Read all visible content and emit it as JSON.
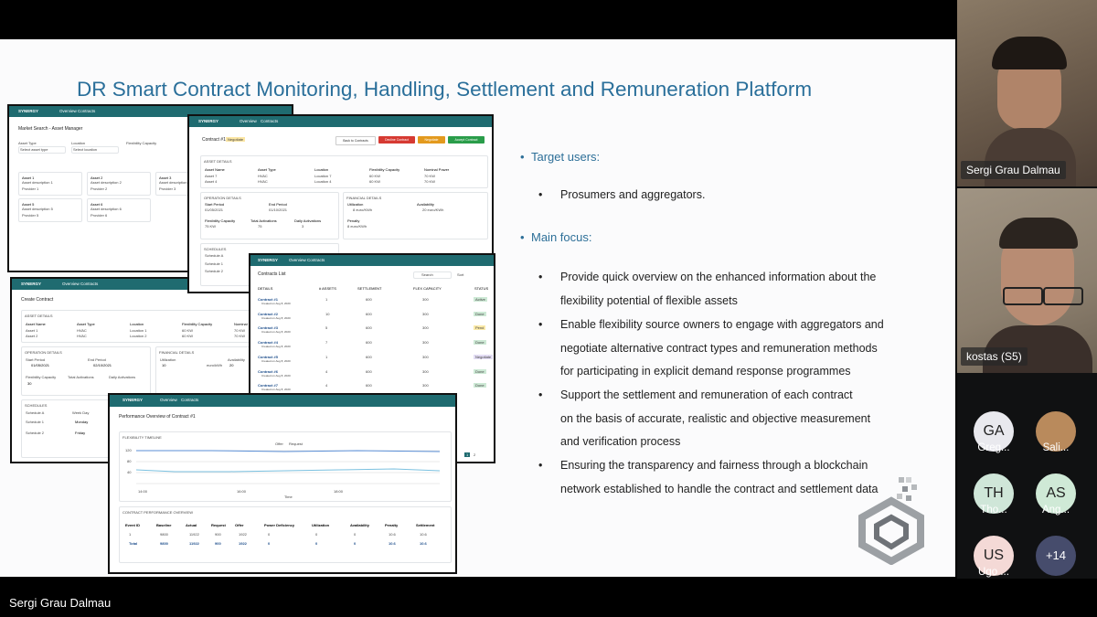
{
  "slide": {
    "title": "DR Smart Contract Monitoring, Handling, Settlement and Remuneration Platform",
    "sections": [
      {
        "heading": "Target users:",
        "items": [
          "Prosumers and aggregators."
        ]
      },
      {
        "heading": "Main focus:",
        "items": [
          [
            "Provide quick overview on the enhanced information about the",
            "flexibility potential of flexible assets"
          ],
          [
            "Enable flexibility source owners to engage with aggregators and",
            "negotiate alternative contract types and remuneration methods",
            "for participating in explicit demand response programmes"
          ],
          [
            "Support the  settlement and remuneration of each contract",
            "on the basis of accurate, realistic and objective measurement",
            "and verification process"
          ],
          [
            "Ensuring the transparency and fairness through a blockchain",
            "network established to handle the contract and settlement data"
          ]
        ]
      }
    ]
  },
  "mockups": {
    "brand": "SYNERGY",
    "nav": [
      "Overview",
      "Contracts"
    ],
    "market": {
      "title": "Market Search - Asset Manager",
      "filters": [
        "Asset Type",
        "Location",
        "Flexibility Capacity"
      ],
      "filter_placeholders": [
        "Select asset type",
        "Select location"
      ],
      "assets": [
        {
          "name": "Asset 1",
          "desc": "Asset description 1",
          "provider": "Provider 1"
        },
        {
          "name": "Asset 2",
          "desc": "Asset description 2",
          "provider": "Provider 2"
        },
        {
          "name": "Asset 3",
          "desc": "Asset description 3",
          "provider": "Provider 3"
        },
        {
          "name": "Asset 5",
          "desc": "Asset description 5",
          "provider": "Provider 5"
        },
        {
          "name": "Asset 6",
          "desc": "Asset description 6",
          "provider": "Provider 6"
        }
      ]
    },
    "contract": {
      "title": "Contract #11",
      "badge": "Negotiate",
      "buttons": [
        "Back to Contracts",
        "Decline Contract",
        "Negotiate",
        "Accept Contract"
      ],
      "asset_details_label": "ASSET DETAILS",
      "asset_cols": [
        "Asset Name",
        "Asset Type",
        "Location",
        "Flexibility Capacity",
        "Nominal Power"
      ],
      "asset_rows": [
        [
          "Asset 7",
          "HVAC",
          "Location 7",
          "60 KW",
          "70 KW"
        ],
        [
          "Asset 4",
          "HVAC",
          "Location 4",
          "60 KW",
          "70 KW"
        ]
      ],
      "operation_label": "OPERATION DETAILS",
      "start_period_label": "Start Period",
      "start_period": "01/05/2021",
      "end_period_label": "End Period",
      "end_period": "01/10/2021",
      "flex_cap_label": "Flexibility Capacity",
      "flex_cap": "75 KW",
      "total_act_label": "Total Activations",
      "total_act": "75",
      "daily_act_label": "Daily Activations",
      "daily_act": "3",
      "financial_label": "FINANCIAL DETAILS",
      "utilization_label": "Utilization",
      "utilization": "8 euro/KWh",
      "availability_label": "Availability",
      "availability": "20 euro/KWh",
      "penalty_label": "Penalty",
      "penalty": "8 euro/KWh",
      "schedules_label": "SCHEDULES",
      "schedules": [
        "Schedule A",
        "Schedule 1",
        "Schedule 2"
      ]
    },
    "create": {
      "title": "Create Contract",
      "asset_details_label": "ASSET DETAILS",
      "asset_cols": [
        "Asset Name",
        "Asset Type",
        "Location",
        "Flexibility Capacity",
        "Nominal Po"
      ],
      "asset_rows": [
        [
          "Asset 1",
          "HVAC",
          "Location 1",
          "60 KW",
          "70 KW"
        ],
        [
          "Asset 2",
          "HVAC",
          "Location 2",
          "60 KW",
          "70 KW"
        ]
      ],
      "operation_label": "OPERATION DETAILS",
      "start_label": "Start Period",
      "start": "01/05/2021",
      "end_label": "End Period",
      "end": "02/10/2021",
      "financial_label": "FINANCIAL DETAILS",
      "utilization_label": "Utilization",
      "utilization": "10",
      "unit": "euro/kWh",
      "availability_label": "Availability",
      "availability": "20",
      "flex_label": "Flexibility Capacity",
      "flex": "30",
      "total_label": "Total Activations",
      "daily_label": "Daily Activations",
      "schedules_label": "SCHEDULES",
      "schedule_a": "Schedule A",
      "week_day": "Week Day",
      "schedule_1": "Schedule 1",
      "schedule_2": "Schedule 2",
      "monday": "Monday",
      "friday": "Friday"
    },
    "contracts_list": {
      "title": "Contracts List",
      "search": "Search",
      "sort": "Sort",
      "cols": [
        "DETAILS",
        "# ASSETS",
        "SETTLEMENT",
        "FLEX CAPACITY",
        "STATUS"
      ],
      "rows": [
        {
          "name": "Contract #1",
          "date": "Created on Aug 8, 2020",
          "assets": "1",
          "settlement": "600",
          "flex": "300",
          "status": "Active",
          "color": "#cde9d5"
        },
        {
          "name": "Contract #2",
          "date": "Created on Aug 8, 2020",
          "assets": "10",
          "settlement": "600",
          "flex": "300",
          "status": "Done",
          "color": "#cde9d5"
        },
        {
          "name": "Contract #3",
          "date": "Created on Aug 8, 2020",
          "assets": "5",
          "settlement": "600",
          "flex": "300",
          "status": "Pend",
          "color": "#fbeaa8"
        },
        {
          "name": "Contract #4",
          "date": "Created on Aug 8, 2020",
          "assets": "7",
          "settlement": "600",
          "flex": "300",
          "status": "Done",
          "color": "#cde9d5"
        },
        {
          "name": "Contract #5",
          "date": "Created on Aug 8, 2020",
          "assets": "1",
          "settlement": "600",
          "flex": "300",
          "status": "Negotiate",
          "color": "#e3ddf4"
        },
        {
          "name": "Contract #6",
          "date": "Created on Aug 8, 2020",
          "assets": "4",
          "settlement": "600",
          "flex": "300",
          "status": "Done",
          "color": "#cde9d5"
        },
        {
          "name": "Contract #7",
          "date": "Created on Aug 8, 2020",
          "assets": "4",
          "settlement": "600",
          "flex": "300",
          "status": "Done",
          "color": "#cde9d5"
        },
        {
          "name": "Contract #8",
          "date": "",
          "assets": "",
          "settlement": "",
          "flex": "",
          "status": "",
          "color": ""
        }
      ],
      "footer": "Showing 7 out of 10 results",
      "pages": [
        "1",
        "2"
      ]
    },
    "performance": {
      "title": "Performance Overview of Contract #1",
      "timeline_label": "FLEXIBILITY TIMELINE",
      "legend": [
        "Offer",
        "Request"
      ],
      "x_label": "Time",
      "y_label": "Flexibility",
      "x_ticks": [
        "14:00",
        "16:00",
        "18:00"
      ],
      "y_ticks": [
        "120",
        "100",
        "80",
        "60",
        "40",
        "20"
      ],
      "table_label": "CONTRACT PERFORMANCE OVERVIEW",
      "cols": [
        "Event ID",
        "Baseline",
        "Actual",
        "Request",
        "Offer",
        "Power Deficiency",
        "Utilization",
        "Availability",
        "Penalty",
        "Settlement"
      ],
      "rows": [
        [
          "1",
          "9800",
          "11922",
          "900",
          "1922",
          "0",
          "0",
          "0",
          "10.6",
          "10.6"
        ],
        [
          "Total",
          "9800",
          "11922",
          "900",
          "1922",
          "0",
          "0",
          "0",
          "10.6",
          "10.6"
        ]
      ]
    }
  },
  "participants": {
    "tiles": [
      {
        "name": "Sergi Grau Dalmau"
      },
      {
        "name": "kostas (S5)"
      }
    ],
    "avatars": [
      {
        "initials": "GA",
        "name": "Greg...",
        "color": "#e9e9ee"
      },
      {
        "initials": "",
        "name": "Sali...",
        "color": "#b98a5c"
      },
      {
        "initials": "TH",
        "name": "Tho...",
        "color": "#cfe6d8"
      },
      {
        "initials": "AS",
        "name": "Ang...",
        "color": "#cfe9d6"
      },
      {
        "initials": "US",
        "name": "Ugo ...",
        "color": "#f4d9d6"
      },
      {
        "initials": "+14",
        "name": "",
        "color": "#464c6c"
      }
    ]
  },
  "presenter": {
    "name": "Sergi Grau Dalmau"
  }
}
